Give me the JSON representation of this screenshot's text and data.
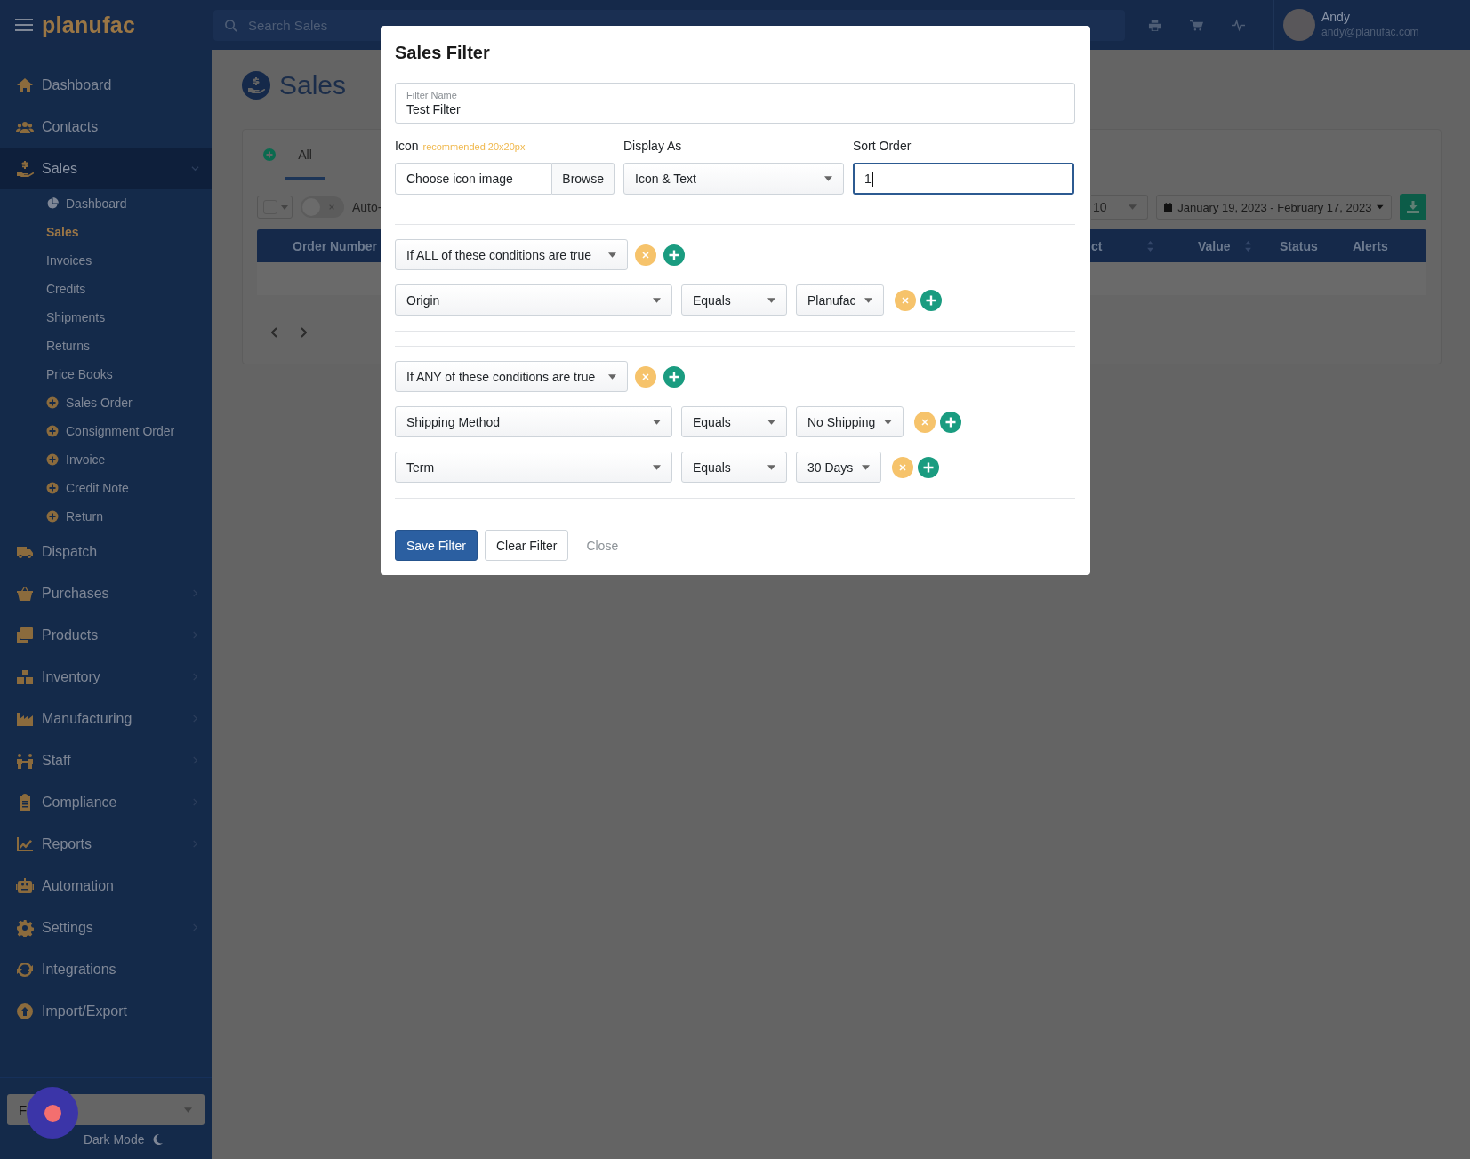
{
  "topbar": {
    "logo": "planufac",
    "search": {
      "placeholder": "Search Sales"
    },
    "user": {
      "name": "Andy",
      "email": "andy@planufac.com"
    }
  },
  "sidebar": {
    "items": [
      {
        "label": "Dashboard",
        "selected": false
      },
      {
        "label": "Contacts",
        "selected": false
      },
      {
        "label": "Sales",
        "selected": true,
        "expanded": true,
        "children": [
          {
            "label": "Dashboard",
            "kind": "chart",
            "selected": false
          },
          {
            "label": "Sales",
            "kind": "link",
            "selected": true
          },
          {
            "label": "Invoices",
            "kind": "link",
            "selected": false
          },
          {
            "label": "Credits",
            "kind": "link",
            "selected": false
          },
          {
            "label": "Shipments",
            "kind": "link",
            "selected": false
          },
          {
            "label": "Returns",
            "kind": "link",
            "selected": false
          },
          {
            "label": "Price Books",
            "kind": "link",
            "selected": false
          },
          {
            "label": "Sales Order",
            "kind": "create",
            "selected": false
          },
          {
            "label": "Consignment Order",
            "kind": "create",
            "selected": false
          },
          {
            "label": "Invoice",
            "kind": "create",
            "selected": false
          },
          {
            "label": "Credit Note",
            "kind": "create",
            "selected": false
          },
          {
            "label": "Return",
            "kind": "create",
            "selected": false
          }
        ]
      },
      {
        "label": "Dispatch",
        "selected": false
      },
      {
        "label": "Purchases",
        "selected": false,
        "expanded": false
      },
      {
        "label": "Products",
        "selected": false,
        "expanded": false
      },
      {
        "label": "Inventory",
        "selected": false,
        "expanded": false
      },
      {
        "label": "Manufacturing",
        "selected": false,
        "expanded": false
      },
      {
        "label": "Staff",
        "selected": false,
        "expanded": false
      },
      {
        "label": "Compliance",
        "selected": false,
        "expanded": false
      },
      {
        "label": "Reports",
        "selected": false,
        "expanded": false
      },
      {
        "label": "Automation",
        "selected": false
      },
      {
        "label": "Settings",
        "selected": false,
        "expanded": false
      },
      {
        "label": "Integrations",
        "selected": false
      },
      {
        "label": "Import/Export",
        "selected": false
      }
    ],
    "footer": {
      "select_value": "F",
      "dark_mode": "Dark Mode"
    }
  },
  "page": {
    "title": "Sales",
    "tabs": [
      {
        "label": "All",
        "selected": true
      }
    ],
    "toolbar": {
      "select_all": {
        "checked": false
      },
      "auto_toggle": {
        "on": false
      },
      "auto_label": "Auto-",
      "page_size": "10",
      "date_range": "January 19, 2023 - February 17, 2023"
    },
    "table": {
      "columns": [
        {
          "label": "Order Number"
        },
        {
          "label": "ct",
          "sortable": true
        },
        {
          "label": "Value",
          "sortable": true
        },
        {
          "label": "Status",
          "sortable": false
        },
        {
          "label": "Alerts",
          "sortable": false
        }
      ]
    }
  },
  "modal": {
    "title": "Sales Filter",
    "filter_name": {
      "label": "Filter Name",
      "value": "Test Filter"
    },
    "icon": {
      "label": "Icon",
      "hint": "recommended 20x20px",
      "file_label": "Choose icon image",
      "button": "Browse"
    },
    "display_as": {
      "label": "Display As",
      "value": "Icon & Text"
    },
    "sort_order": {
      "label": "Sort Order",
      "value": "1",
      "focused": true
    },
    "groups": [
      {
        "match": "If ALL of these conditions are true",
        "conditions": [
          {
            "field": "Origin",
            "operator": "Equals",
            "value": "Planufac"
          }
        ]
      },
      {
        "match": "If ANY of these conditions are true",
        "conditions": [
          {
            "field": "Shipping Method",
            "operator": "Equals",
            "value": "No Shipping"
          },
          {
            "field": "Term",
            "operator": "Equals",
            "value": "30 Days"
          }
        ]
      }
    ],
    "buttons": [
      {
        "label": "Save Filter",
        "kind": "primary"
      },
      {
        "label": "Clear Filter",
        "kind": "secondary"
      },
      {
        "label": "Close",
        "kind": "link"
      }
    ]
  }
}
